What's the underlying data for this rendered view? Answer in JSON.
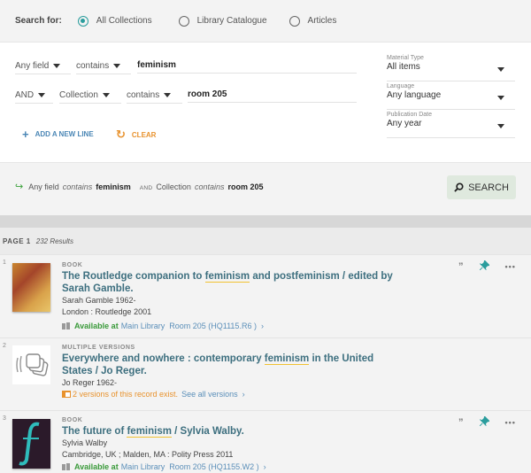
{
  "search_for": {
    "label": "Search for:",
    "options": [
      {
        "label": "All Collections",
        "selected": true
      },
      {
        "label": "Library Catalogue",
        "selected": false
      },
      {
        "label": "Articles",
        "selected": false
      }
    ]
  },
  "advanced": {
    "line1": {
      "field": "Any field",
      "operator": "contains",
      "value": "feminism"
    },
    "line2": {
      "boolean": "AND",
      "field": "Collection",
      "operator": "contains",
      "value": "room 205"
    },
    "add_line_label": "ADD A NEW LINE",
    "clear_label": "CLEAR",
    "filters": [
      {
        "label": "Material Type",
        "value": "All items"
      },
      {
        "label": "Language",
        "value": "Any language"
      },
      {
        "label": "Publication Date",
        "value": "Any year"
      }
    ]
  },
  "query_summary": {
    "field1": "Any field",
    "op1": "contains",
    "value1": "feminism",
    "boolean": "AND",
    "field2": "Collection",
    "op2": "contains",
    "value2": "room 205"
  },
  "search_button": "SEARCH",
  "results_header": {
    "page": "PAGE 1",
    "count": "232 Results"
  },
  "results": [
    {
      "number": "1",
      "type": "BOOK",
      "title_pre": "The Routledge companion to ",
      "title_hl": "feminism",
      "title_post": " and postfeminism / edited by Sarah Gamble.",
      "author": "Sarah Gamble 1962-",
      "publisher": "London : Routledge 2001",
      "availability": "Available at",
      "location": "Main Library",
      "shelf": "Room 205 (HQ1115.R6 )"
    },
    {
      "number": "2",
      "type": "MULTIPLE VERSIONS",
      "title_pre": "Everywhere and nowhere : contemporary ",
      "title_hl": "feminism",
      "title_post": " in the United States / Jo Reger.",
      "author": "Jo Reger 1962-",
      "versions_text": "2 versions of this record exist.",
      "see_all": "See all versions"
    },
    {
      "number": "3",
      "type": "BOOK",
      "title_pre": "The future of ",
      "title_hl": "feminism",
      "title_post": " / Sylvia Walby.",
      "author": "Sylvia Walby",
      "publisher": "Cambridge, UK ; Malden, MA : Polity Press 2011",
      "availability": "Available at",
      "location": "Main Library",
      "shelf": "Room 205 (HQ1155.W2 )"
    }
  ],
  "icons": {
    "cite": "”",
    "pin": "pin-icon",
    "more": "•••",
    "chevron": "›",
    "plus": "+",
    "clear": "↻",
    "arrow": "↪"
  }
}
